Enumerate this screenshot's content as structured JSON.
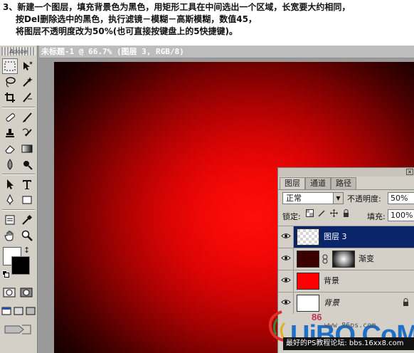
{
  "instructions": {
    "line1": "3、新建一个图层，填充背景色为黑色，用矩形工具在中间选出一个区域，长宽要大约相同，",
    "line2": "按Del删除选中的黑色，执行滤镜－模糊－高斯模糊，数值45，",
    "line3": "将图层不透明度改为50%(也可直接按键盘上的5快捷键)。"
  },
  "document": {
    "title": "未标题-1 @ 66.7% (图层 3, RGB/8)"
  },
  "toolbox": {
    "logo": "Adobe",
    "swap": "↕"
  },
  "layers_panel": {
    "tabs": [
      "图层",
      "通道",
      "路径"
    ],
    "blend_mode": "正常",
    "blend_arrow": "▼",
    "opacity_label": "不透明度:",
    "opacity_value": "50%",
    "lock_label": "锁定:",
    "fill_label": "填充:",
    "fill_value": "100%",
    "layers": [
      {
        "name": "图层 3",
        "selected": true,
        "visible": true
      },
      {
        "name": "渐变",
        "selected": false,
        "visible": true
      },
      {
        "name": "背景",
        "selected": false,
        "visible": true
      },
      {
        "name": "背景",
        "selected": false,
        "visible": true,
        "locked": true
      }
    ],
    "colors": {
      "selected": "#0a246a",
      "canvas": "#ff0000"
    }
  },
  "watermark": {
    "logo": "UiBQ.CoM",
    "url": "www.86ps.com",
    "number": "86",
    "banner": "最好的PS教程论坛: bbs.16xx8.com"
  }
}
